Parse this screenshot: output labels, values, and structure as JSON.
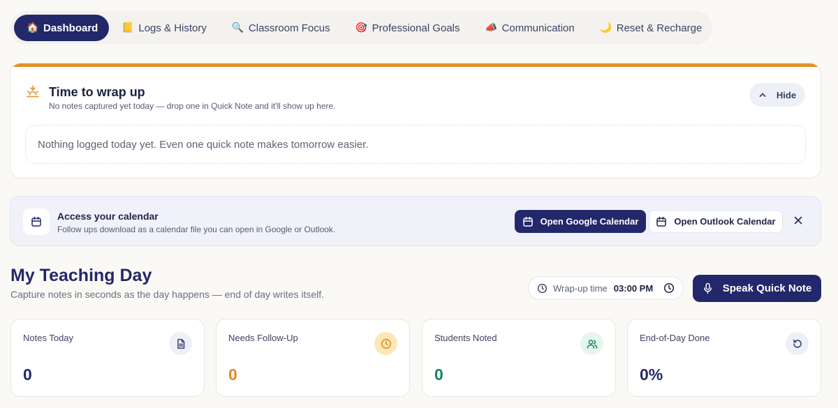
{
  "nav": {
    "items": [
      {
        "label": "Dashboard",
        "icon": "🏠",
        "active": true
      },
      {
        "label": "Logs & History",
        "icon": "📒",
        "active": false
      },
      {
        "label": "Classroom Focus",
        "icon": "🔍",
        "active": false
      },
      {
        "label": "Professional Goals",
        "icon": "🎯",
        "active": false
      },
      {
        "label": "Communication",
        "icon": "📣",
        "active": false
      },
      {
        "label": "Reset & Recharge",
        "icon": "🌙",
        "active": false
      }
    ]
  },
  "wrapup": {
    "title": "Time to wrap up",
    "subtitle": "No notes captured yet today — drop one in Quick Note and it'll show up here.",
    "hide_label": "Hide",
    "empty_text": "Nothing logged today yet. Even one quick note makes tomorrow easier.",
    "accent": "#e2902a"
  },
  "calendar": {
    "title": "Access your calendar",
    "subtitle": "Follow ups download as a calendar file you can open in Google or Outlook.",
    "google_label": "Open Google Calendar",
    "outlook_label": "Open Outlook Calendar"
  },
  "page": {
    "title": "My Teaching Day",
    "subtitle": "Capture notes in seconds as the day happens — end of day writes itself.",
    "wrapup_time_label": "Wrap-up time",
    "wrapup_time_value": "03:00 PM",
    "speak_label": "Speak Quick Note"
  },
  "stats": [
    {
      "label": "Notes Today",
      "value": "0",
      "icon": "document-icon",
      "color": "#23286b",
      "icon_bg": "#eef0f8",
      "icon_color": "#3a4070"
    },
    {
      "label": "Needs Follow-Up",
      "value": "0",
      "icon": "clock-icon",
      "color": "#e0892a",
      "icon_bg": "#fde7b5",
      "icon_color": "#e0892a"
    },
    {
      "label": "Students Noted",
      "value": "0",
      "icon": "users-icon",
      "color": "#14845a",
      "icon_bg": "#e6f6ee",
      "icon_color": "#14845a"
    },
    {
      "label": "End-of-Day Done",
      "value": "0%",
      "icon": "refresh-icon",
      "color": "#23286b",
      "icon_bg": "#eef0f8",
      "icon_color": "#3a4070"
    }
  ],
  "colors": {
    "brand": "#23286b",
    "background": "#faf9f6"
  }
}
